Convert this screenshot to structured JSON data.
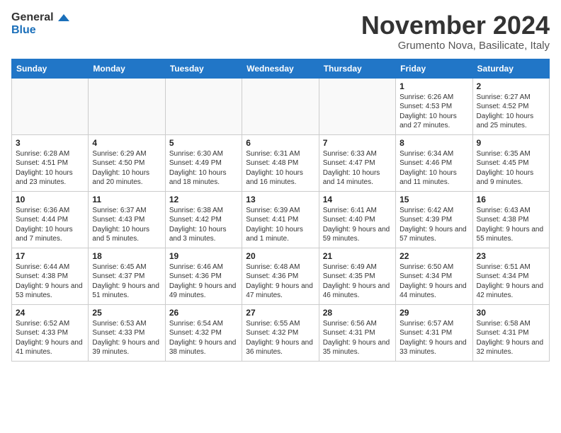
{
  "header": {
    "logo_line1": "General",
    "logo_line2": "Blue",
    "month_title": "November 2024",
    "location": "Grumento Nova, Basilicate, Italy"
  },
  "weekdays": [
    "Sunday",
    "Monday",
    "Tuesday",
    "Wednesday",
    "Thursday",
    "Friday",
    "Saturday"
  ],
  "weeks": [
    [
      {
        "day": "",
        "info": ""
      },
      {
        "day": "",
        "info": ""
      },
      {
        "day": "",
        "info": ""
      },
      {
        "day": "",
        "info": ""
      },
      {
        "day": "",
        "info": ""
      },
      {
        "day": "1",
        "info": "Sunrise: 6:26 AM\nSunset: 4:53 PM\nDaylight: 10 hours and 27 minutes."
      },
      {
        "day": "2",
        "info": "Sunrise: 6:27 AM\nSunset: 4:52 PM\nDaylight: 10 hours and 25 minutes."
      }
    ],
    [
      {
        "day": "3",
        "info": "Sunrise: 6:28 AM\nSunset: 4:51 PM\nDaylight: 10 hours and 23 minutes."
      },
      {
        "day": "4",
        "info": "Sunrise: 6:29 AM\nSunset: 4:50 PM\nDaylight: 10 hours and 20 minutes."
      },
      {
        "day": "5",
        "info": "Sunrise: 6:30 AM\nSunset: 4:49 PM\nDaylight: 10 hours and 18 minutes."
      },
      {
        "day": "6",
        "info": "Sunrise: 6:31 AM\nSunset: 4:48 PM\nDaylight: 10 hours and 16 minutes."
      },
      {
        "day": "7",
        "info": "Sunrise: 6:33 AM\nSunset: 4:47 PM\nDaylight: 10 hours and 14 minutes."
      },
      {
        "day": "8",
        "info": "Sunrise: 6:34 AM\nSunset: 4:46 PM\nDaylight: 10 hours and 11 minutes."
      },
      {
        "day": "9",
        "info": "Sunrise: 6:35 AM\nSunset: 4:45 PM\nDaylight: 10 hours and 9 minutes."
      }
    ],
    [
      {
        "day": "10",
        "info": "Sunrise: 6:36 AM\nSunset: 4:44 PM\nDaylight: 10 hours and 7 minutes."
      },
      {
        "day": "11",
        "info": "Sunrise: 6:37 AM\nSunset: 4:43 PM\nDaylight: 10 hours and 5 minutes."
      },
      {
        "day": "12",
        "info": "Sunrise: 6:38 AM\nSunset: 4:42 PM\nDaylight: 10 hours and 3 minutes."
      },
      {
        "day": "13",
        "info": "Sunrise: 6:39 AM\nSunset: 4:41 PM\nDaylight: 10 hours and 1 minute."
      },
      {
        "day": "14",
        "info": "Sunrise: 6:41 AM\nSunset: 4:40 PM\nDaylight: 9 hours and 59 minutes."
      },
      {
        "day": "15",
        "info": "Sunrise: 6:42 AM\nSunset: 4:39 PM\nDaylight: 9 hours and 57 minutes."
      },
      {
        "day": "16",
        "info": "Sunrise: 6:43 AM\nSunset: 4:38 PM\nDaylight: 9 hours and 55 minutes."
      }
    ],
    [
      {
        "day": "17",
        "info": "Sunrise: 6:44 AM\nSunset: 4:38 PM\nDaylight: 9 hours and 53 minutes."
      },
      {
        "day": "18",
        "info": "Sunrise: 6:45 AM\nSunset: 4:37 PM\nDaylight: 9 hours and 51 minutes."
      },
      {
        "day": "19",
        "info": "Sunrise: 6:46 AM\nSunset: 4:36 PM\nDaylight: 9 hours and 49 minutes."
      },
      {
        "day": "20",
        "info": "Sunrise: 6:48 AM\nSunset: 4:36 PM\nDaylight: 9 hours and 47 minutes."
      },
      {
        "day": "21",
        "info": "Sunrise: 6:49 AM\nSunset: 4:35 PM\nDaylight: 9 hours and 46 minutes."
      },
      {
        "day": "22",
        "info": "Sunrise: 6:50 AM\nSunset: 4:34 PM\nDaylight: 9 hours and 44 minutes."
      },
      {
        "day": "23",
        "info": "Sunrise: 6:51 AM\nSunset: 4:34 PM\nDaylight: 9 hours and 42 minutes."
      }
    ],
    [
      {
        "day": "24",
        "info": "Sunrise: 6:52 AM\nSunset: 4:33 PM\nDaylight: 9 hours and 41 minutes."
      },
      {
        "day": "25",
        "info": "Sunrise: 6:53 AM\nSunset: 4:33 PM\nDaylight: 9 hours and 39 minutes."
      },
      {
        "day": "26",
        "info": "Sunrise: 6:54 AM\nSunset: 4:32 PM\nDaylight: 9 hours and 38 minutes."
      },
      {
        "day": "27",
        "info": "Sunrise: 6:55 AM\nSunset: 4:32 PM\nDaylight: 9 hours and 36 minutes."
      },
      {
        "day": "28",
        "info": "Sunrise: 6:56 AM\nSunset: 4:31 PM\nDaylight: 9 hours and 35 minutes."
      },
      {
        "day": "29",
        "info": "Sunrise: 6:57 AM\nSunset: 4:31 PM\nDaylight: 9 hours and 33 minutes."
      },
      {
        "day": "30",
        "info": "Sunrise: 6:58 AM\nSunset: 4:31 PM\nDaylight: 9 hours and 32 minutes."
      }
    ]
  ]
}
